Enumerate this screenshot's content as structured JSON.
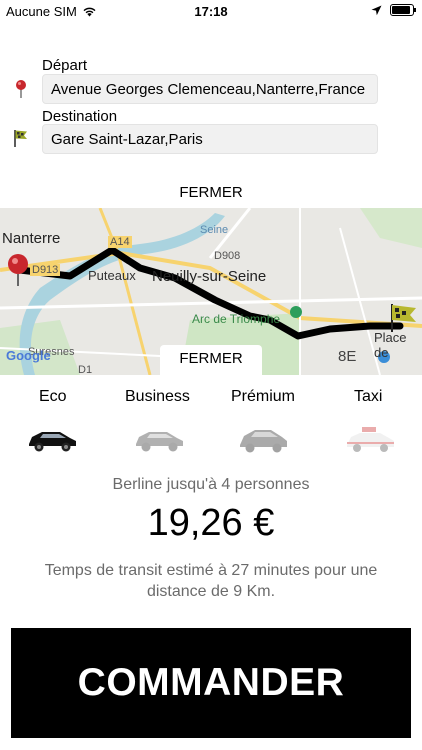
{
  "status_bar": {
    "carrier": "Aucune SIM",
    "time": "17:18"
  },
  "form": {
    "depart_label": "Départ",
    "depart_value": "Avenue Georges Clemenceau,Nanterre,France",
    "destination_label": "Destination",
    "destination_value": "Gare Saint-Lazar,Paris"
  },
  "fermer_top": "FERMER",
  "map": {
    "labels": {
      "nanterre": "Nanterre",
      "puteaux": "Puteaux",
      "neuilly": "Neuilly-sur-Seine",
      "arc": "Arc de Triomphe",
      "a14": "A14",
      "d908": "D908",
      "d913": "D913",
      "seine": "Seine",
      "suresnes": "Suresnes",
      "d1": "D1",
      "place": "Place de",
      "eighth": "8E",
      "google": "Google"
    },
    "fermer_tab": "FERMER"
  },
  "vehicle_tabs": [
    "Eco",
    "Business",
    "Prémium",
    "Taxi"
  ],
  "selected_tab": "Eco",
  "vehicle_desc": "Berline jusqu'à 4 personnes",
  "price": "19,26 €",
  "transit_text": "Temps de transit estimé à 27 minutes pour une distance de 9 Km.",
  "commander_label": "COMMANDER"
}
